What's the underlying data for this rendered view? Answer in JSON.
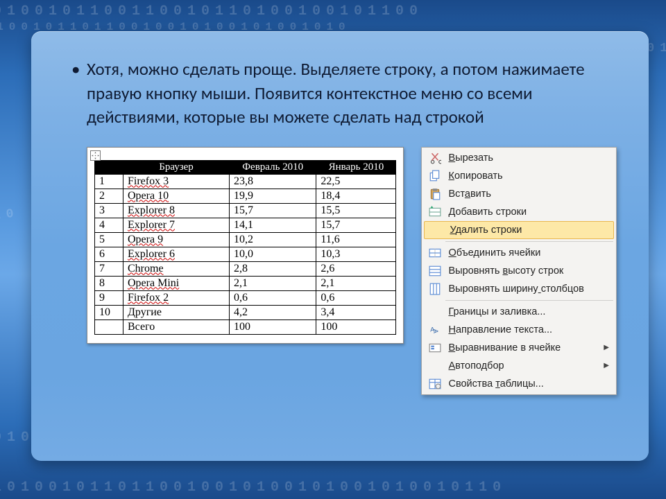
{
  "bullet": "Хотя, можно сделать проще. Выделяете строку, а потом нажимаете правую кнопку мыши. Появится контекстное меню со всеми действиями, которые вы можете сделать над строкой",
  "table": {
    "headers": [
      "",
      "Браузер",
      "Февраль 2010",
      "Январь 2010"
    ],
    "rows": [
      {
        "n": "1",
        "name": "Firefox 3",
        "feb": "23,8",
        "jan": "22,5",
        "squiggle": true
      },
      {
        "n": "2",
        "name": "Opera 10",
        "feb": "19,9",
        "jan": "18,4",
        "squiggle": true
      },
      {
        "n": "3",
        "name": "Explorer 8",
        "feb": "15,7",
        "jan": "15,5",
        "squiggle": true
      },
      {
        "n": "4",
        "name": "Explorer 7",
        "feb": "14,1",
        "jan": "15,7",
        "squiggle": true
      },
      {
        "n": "5",
        "name": "Opera 9",
        "feb": "10,2",
        "jan": "11,6",
        "squiggle": true
      },
      {
        "n": "6",
        "name": "Explorer 6",
        "feb": "10,0",
        "jan": "10,3",
        "squiggle": true
      },
      {
        "n": "7",
        "name": "Chrome",
        "feb": "2,8",
        "jan": "2,6",
        "squiggle": true
      },
      {
        "n": "8",
        "name": "Opera Mini",
        "feb": "2,1",
        "jan": "2,1",
        "squiggle": true
      },
      {
        "n": "9",
        "name": "Firefox 2",
        "feb": "0,6",
        "jan": "0,6",
        "squiggle": true
      },
      {
        "n": "10",
        "name": "Другие",
        "feb": "4,2",
        "jan": "3,4",
        "squiggle": false
      },
      {
        "n": "",
        "name": "Всего",
        "feb": "100",
        "jan": "100",
        "squiggle": false
      }
    ]
  },
  "context_menu": {
    "items": [
      {
        "label": "Вырезать",
        "u": 0,
        "icon": "cut-icon"
      },
      {
        "label": "Копировать",
        "u": 0,
        "icon": "copy-icon"
      },
      {
        "label": "Вставить",
        "u": 3,
        "icon": "paste-icon"
      },
      {
        "label": "Добавить строки",
        "u": 0,
        "icon": "insert-rows-icon"
      },
      {
        "label": "Удалить строки",
        "u": 0,
        "icon": "",
        "hover": true
      },
      {
        "sep": true
      },
      {
        "label": "Объединить ячейки",
        "u": 0,
        "icon": "merge-cells-icon"
      },
      {
        "label": "Выровнять высоту строк",
        "u": 10,
        "icon": "distribute-rows-icon"
      },
      {
        "label": "Выровнять ширину столбцов",
        "u": 16,
        "icon": "distribute-cols-icon"
      },
      {
        "sep": true
      },
      {
        "label": "Границы и заливка...",
        "u": 0,
        "icon": ""
      },
      {
        "label": "Направление текста...",
        "u": 0,
        "icon": "text-direction-icon"
      },
      {
        "label": "Выравнивание в ячейке",
        "u": 0,
        "icon": "align-cell-icon",
        "arrow": true
      },
      {
        "label": "Автоподбор",
        "u": 0,
        "icon": "",
        "arrow": true
      },
      {
        "label": "Свойства таблицы...",
        "u": 9,
        "icon": "table-props-icon"
      }
    ]
  }
}
